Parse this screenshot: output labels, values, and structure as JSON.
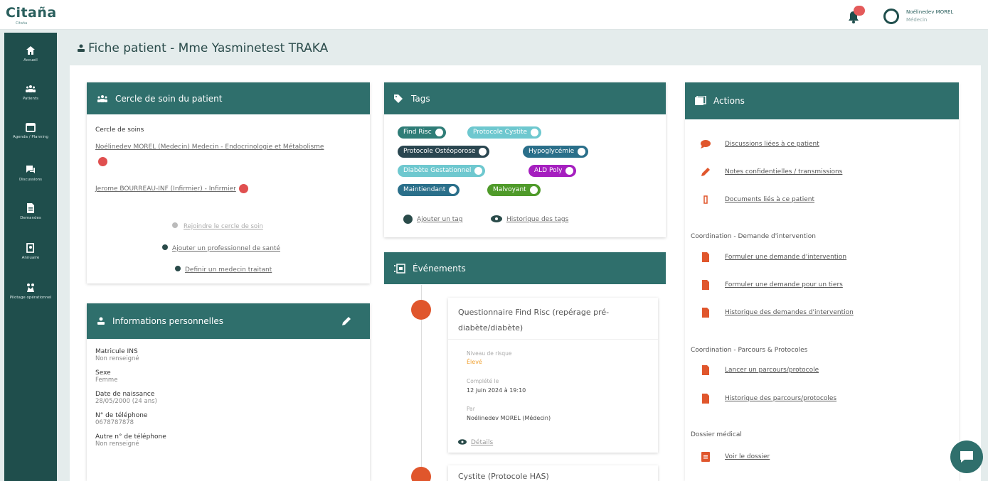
{
  "app": {
    "logo": "Citaña",
    "logo_sub": "Citaña"
  },
  "header": {
    "user_name": "Noélinedev MOREL",
    "user_role": "Médecin"
  },
  "sidebar": {
    "items": [
      {
        "label": "Accueil",
        "icon": "home-icon"
      },
      {
        "label": "Patients",
        "icon": "users-icon"
      },
      {
        "label": "Agenda / Planning",
        "icon": "calendar-icon"
      },
      {
        "label": "Discussions",
        "icon": "chat-icon"
      },
      {
        "label": "Demandes",
        "icon": "file-icon"
      },
      {
        "label": "Annuaire",
        "icon": "book-icon"
      },
      {
        "label": "Pilotage opérationnel",
        "icon": "network-icon"
      }
    ]
  },
  "page": {
    "title": "Fiche patient - Mme Yasminetest TRAKA"
  },
  "care_circle": {
    "title": "Cercle de soin du patient",
    "section_label": "Cercle de soins",
    "member1": "Noélinedev MOREL (Medecin) Medecin - Endocrinologie et Métabolisme",
    "member2": "Jerome BOURREAU-INF (Infirmier) - Infirmier",
    "join": "Rejoindre le cercle de soin",
    "add_pro": "Ajouter un professionnel de santé",
    "set_doctor": "Definir un medecin traitant"
  },
  "personal": {
    "title": "Informations personnelles",
    "fields": [
      {
        "label": "Matricule INS",
        "value": "Non renseigné"
      },
      {
        "label": "Sexe",
        "value": "Femme"
      },
      {
        "label": "Date de naissance",
        "value": "28/05/2000 (24 ans)"
      },
      {
        "label": "N° de téléphone",
        "value": "0678787878"
      },
      {
        "label": "Autre n° de téléphone",
        "value": "Non renseigné"
      }
    ]
  },
  "tags": {
    "title": "Tags",
    "items": [
      {
        "label": "Find Risc",
        "color": "#2f7d77"
      },
      {
        "label": "Protocole Cystite",
        "color": "#6ec8cf"
      },
      {
        "label": "Protocole Ostéoporose",
        "color": "#2a4650"
      },
      {
        "label": "Hypoglycémie",
        "color": "#2a6f8a"
      },
      {
        "label": "Diabète Gestationnel",
        "color": "#6ec8cf"
      },
      {
        "label": "ALD Poly",
        "color": "#a51fbf"
      },
      {
        "label": "Maintiendant",
        "color": "#2a6f8a"
      },
      {
        "label": "Malvoyant",
        "color": "#4f9a2a"
      }
    ],
    "add": "Ajouter un tag",
    "history": "Historique des tags"
  },
  "events": {
    "title": "Événements",
    "event1_title": "Questionnaire Find Risc (repérage pré-diabète/diabète)",
    "risk_label": "Niveau de risque",
    "risk_value": "Élevé",
    "completed_label": "Complété le",
    "completed_value": "12 juin 2024 à 19:10",
    "by_label": "Par",
    "by_value": "Noélinedev MOREL (Médecin)",
    "details": "Détails",
    "event2_title": "Cystite (Protocole HAS)"
  },
  "actions": {
    "title": "Actions",
    "top": [
      "Discussions liées à ce patient",
      "Notes confidentielles / transmissions",
      "Documents liés à ce patient"
    ],
    "sec1": "Coordination - Demande d'intervention",
    "sec1_items": [
      "Formuler une demande d'intervention",
      "Formuler une demande pour un tiers",
      "Historique des demandes d'intervention"
    ],
    "sec2": "Coordination - Parcours & Protocoles",
    "sec2_items": [
      "Lancer un parcours/protocole",
      "Historique des parcours/protocoles"
    ],
    "sec3": "Dossier médical",
    "sec3_items": [
      "Voir le dossier"
    ]
  }
}
